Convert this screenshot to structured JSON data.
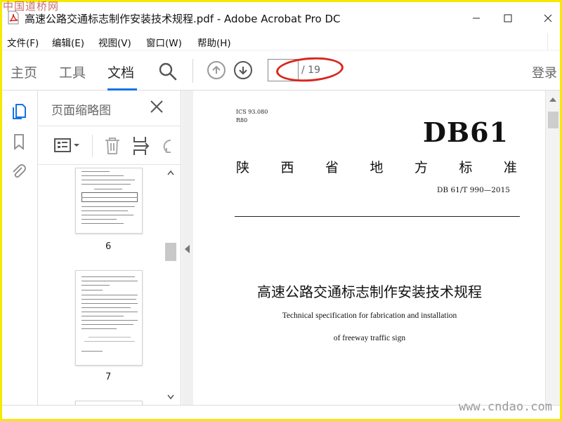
{
  "window": {
    "title": "高速公路交通标志制作安装技术规程.pdf - Adobe Acrobat Pro DC",
    "controls": [
      "minimize",
      "maximize",
      "close"
    ]
  },
  "watermarks": {
    "top_left": "中国道桥网",
    "bottom_right": "www.cndao.com"
  },
  "menu": {
    "items": [
      "文件(F)",
      "编辑(E)",
      "视图(V)",
      "窗口(W)",
      "帮助(H)"
    ]
  },
  "toolbar": {
    "tabs": [
      "主页",
      "工具",
      "文档"
    ],
    "active_tab": "文档",
    "page_current": "",
    "page_total": "/ 19",
    "login_label": "登录",
    "icons": [
      "search-icon",
      "page-up-icon",
      "page-down-icon"
    ]
  },
  "sidebar": {
    "icons": [
      "page-thumbnails-icon",
      "bookmark-icon",
      "attachment-icon"
    ],
    "panel_title": "页面缩略图",
    "tool_icons": [
      "thumbnail-options-icon",
      "delete-page-icon",
      "insert-page-icon",
      "rotate-page-icon"
    ],
    "thumbnails": [
      {
        "page": "6"
      },
      {
        "page": "7"
      }
    ]
  },
  "document": {
    "ics": "ICS 93.080",
    "category": "R80",
    "code": "DB61",
    "province": [
      "陕",
      "西",
      "省",
      "地",
      "方",
      "标",
      "准"
    ],
    "standard_no": "DB 61/T 990—2015",
    "title_cn": "高速公路交通标志制作安装技术规程",
    "title_en_line1": "Technical specification for fabrication and installation",
    "title_en_line2": "of freeway traffic sign"
  },
  "colors": {
    "accent": "#1473e6",
    "highlight_ellipse": "#d9261c",
    "frame": "#f5e900"
  }
}
